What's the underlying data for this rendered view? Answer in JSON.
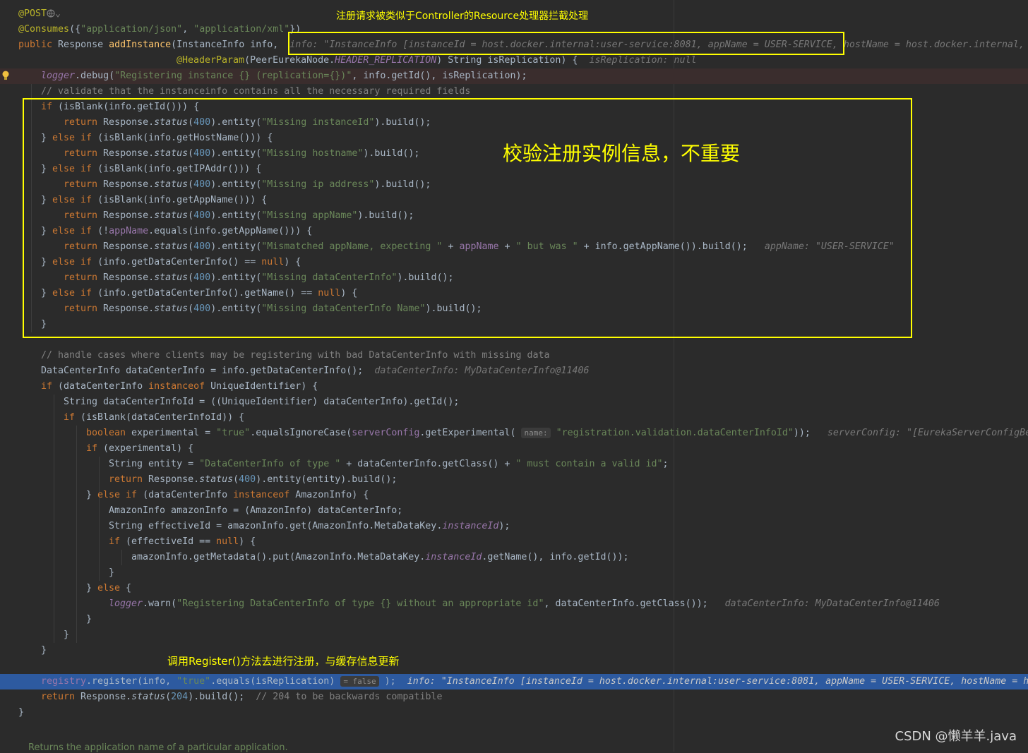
{
  "annotations": {
    "top": "注册请求被类似于Controller的Resource处理器拦截处理",
    "middle": "校验注册实例信息，不重要",
    "bottom": "调用Register()方法去进行注册，与缓存信息更新"
  },
  "watermark": "CSDN @懒羊羊.java",
  "footer_doc": "Returns the application name of a particular application.",
  "hints": {
    "info": "info: \"InstanceInfo [instanceId = host.docker.internal:user-service:8081, appName = USER-SERVICE,",
    "info_tail": " hostName = host.docker.internal,",
    "isReplication": "isReplication: null",
    "appName": "appName: \"USER-SERVICE\"",
    "dataCenterInfo": "dataCenterInfo: MyDataCenterInfo@11406",
    "serverConfig": "serverConfig: \"[EurekaServerConfigBea",
    "param_name": "name:",
    "param_false": "= false",
    "register_info": "info: \"InstanceInfo [instanceId = host.docker.internal:user-service:8081, appName = USER-SERVICE, hostName = hos"
  },
  "comments": {
    "validate": "// validate that the instanceinfo contains all the necessary required fields",
    "handle": "// handle cases where clients may be registering with bad DataCenterInfo with missing data",
    "compat": "// 204 to be backwards compatible"
  },
  "strings": {
    "missing_id": "\"Missing instanceId\"",
    "missing_host": "\"Missing hostname\"",
    "missing_ip": "\"Missing ip address\"",
    "missing_app": "\"Missing appName\"",
    "mismatch": "\"Mismatched appName, expecting \"",
    "but_was": "\" but was \"",
    "missing_dc": "\"Missing dataCenterInfo\"",
    "missing_dc_name": "\"Missing dataCenterInfo Name\"",
    "true": "\"true\"",
    "reg_key": "\"registration.validation.dataCenterInfoId\"",
    "dc_type": "\"DataCenterInfo of type \"",
    "must_contain": "\" must contain a valid id\"",
    "warn_msg": "\"Registering DataCenterInfo of type {} without an appropriate id\"",
    "reg_instance": "\"Registering instance {} (replication={})\"",
    "json": "\"application/json\"",
    "xml": "\"application/xml\""
  },
  "colors": {
    "background": "#2b2b2b",
    "annotation": "#ffff00",
    "exec_line": "#2d5aa0"
  }
}
